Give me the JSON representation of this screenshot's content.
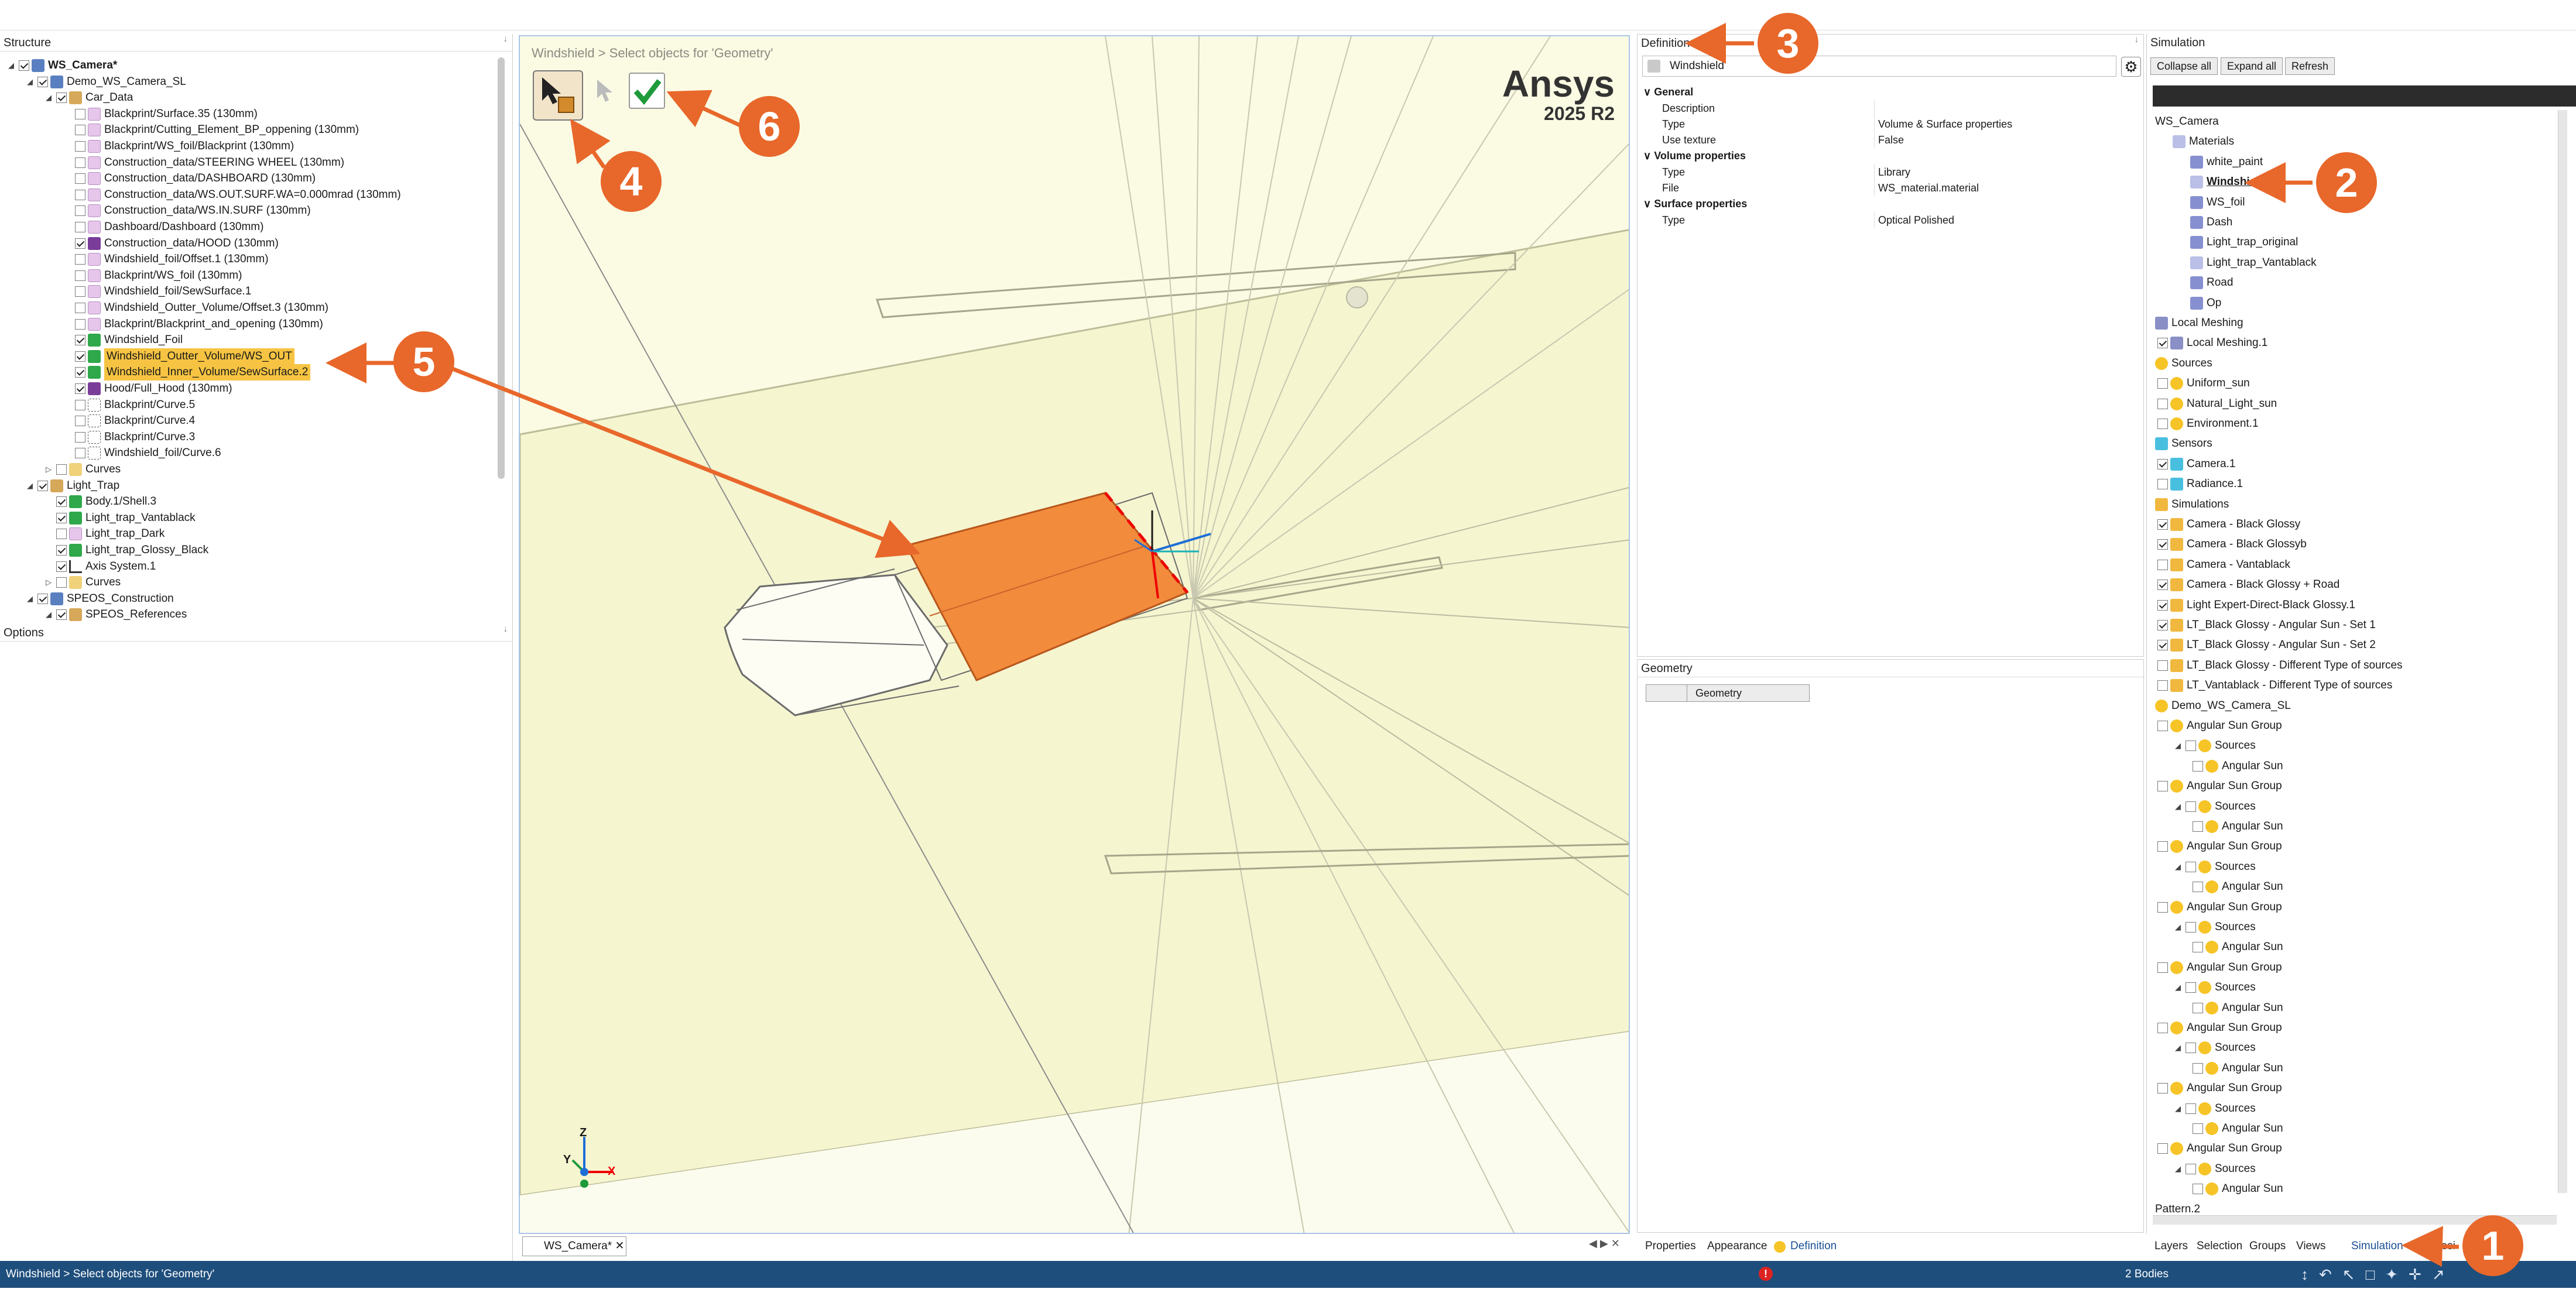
{
  "structure": {
    "title": "Structure",
    "rows": [
      {
        "label": "WS_Camera*",
        "bold": true
      },
      {
        "label": "Demo_WS_Camera_SL"
      },
      {
        "label": "Car_Data"
      },
      {
        "label": "Blackprint/Surface.35 (130mm)"
      },
      {
        "label": "Blackprint/Cutting_Element_BP_oppening (130mm)"
      },
      {
        "label": "Blackprint/WS_foil/Blackprint (130mm)"
      },
      {
        "label": "Construction_data/STEERING WHEEL (130mm)"
      },
      {
        "label": "Construction_data/DASHBOARD (130mm)"
      },
      {
        "label": "Construction_data/WS.OUT.SURF.WA=0.000mrad (130mm)"
      },
      {
        "label": "Construction_data/WS.IN.SURF (130mm)"
      },
      {
        "label": "Dashboard/Dashboard (130mm)"
      },
      {
        "label": "Construction_data/HOOD (130mm)"
      },
      {
        "label": "Windshield_foil/Offset.1 (130mm)"
      },
      {
        "label": "Blackprint/WS_foil (130mm)"
      },
      {
        "label": "Windshield_foil/SewSurface.1"
      },
      {
        "label": "Windshield_Outter_Volume/Offset.3 (130mm)"
      },
      {
        "label": "Blackprint/Blackprint_and_opening (130mm)"
      },
      {
        "label": "Windshield_Foil"
      },
      {
        "label": "Windshield_Outter_Volume/WS_OUT"
      },
      {
        "label": "Windshield_Inner_Volume/SewSurface.2"
      },
      {
        "label": "Hood/Full_Hood (130mm)"
      },
      {
        "label": "Blackprint/Curve.5"
      },
      {
        "label": "Blackprint/Curve.4"
      },
      {
        "label": "Blackprint/Curve.3"
      },
      {
        "label": "Windshield_foil/Curve.6"
      },
      {
        "label": "Curves"
      },
      {
        "label": "Light_Trap"
      },
      {
        "label": "Body.1/Shell.3"
      },
      {
        "label": "Light_trap_Vantablack"
      },
      {
        "label": "Light_trap_Dark"
      },
      {
        "label": "Light_trap_Glossy_Black"
      },
      {
        "label": "Axis System.1"
      },
      {
        "label": "Curves"
      },
      {
        "label": "SPEOS_Construction"
      },
      {
        "label": "SPEOS_References"
      }
    ]
  },
  "options": {
    "title": "Options"
  },
  "viewport": {
    "breadcrumb": "Windshield > Select objects for 'Geometry'",
    "brand": "Ansys",
    "version": "2025 R2",
    "axis_x": "X",
    "axis_y": "Y",
    "axis_z": "Z",
    "tab": "WS_Camera*"
  },
  "definition": {
    "title": "Definition",
    "name": "Windshield",
    "sections": [
      {
        "title": "General",
        "props": [
          [
            "Description",
            ""
          ],
          [
            "Type",
            "Volume & Surface properties"
          ],
          [
            "Use texture",
            "False"
          ]
        ]
      },
      {
        "title": "Volume properties",
        "props": [
          [
            "Type",
            "Library"
          ],
          [
            "File",
            "WS_material.material"
          ]
        ]
      },
      {
        "title": "Surface properties",
        "props": [
          [
            "Type",
            "Optical Polished"
          ]
        ]
      }
    ]
  },
  "geometry": {
    "title": "Geometry",
    "column": "Geometry"
  },
  "center_tabs": [
    "Properties",
    "Appearance",
    "Definition"
  ],
  "simulation": {
    "title": "Simulation",
    "buttons": [
      "Collapse all",
      "Expand all",
      "Refresh"
    ],
    "rows": [
      {
        "label": "WS_Camera"
      },
      {
        "label": "Materials"
      },
      {
        "label": "white_paint"
      },
      {
        "label": "Windshield"
      },
      {
        "label": "WS_foil"
      },
      {
        "label": "Dash"
      },
      {
        "label": "Light_trap_original"
      },
      {
        "label": "Light_trap_Vantablack"
      },
      {
        "label": "Road"
      },
      {
        "label": "Op"
      },
      {
        "label": "Local Meshing"
      },
      {
        "label": "Local Meshing.1"
      },
      {
        "label": "Sources"
      },
      {
        "label": "Uniform_sun"
      },
      {
        "label": "Natural_Light_sun"
      },
      {
        "label": "Environment.1"
      },
      {
        "label": "Sensors"
      },
      {
        "label": "Camera.1"
      },
      {
        "label": "Radiance.1"
      },
      {
        "label": "Simulations"
      },
      {
        "label": "Camera -  Black Glossy"
      },
      {
        "label": "Camera -  Black Glossyb"
      },
      {
        "label": "Camera - Vantablack"
      },
      {
        "label": "Camera - Black Glossy + Road"
      },
      {
        "label": "Light Expert-Direct-Black Glossy.1"
      },
      {
        "label": "LT_Black Glossy - Angular Sun - Set 1"
      },
      {
        "label": "LT_Black Glossy - Angular Sun - Set 2"
      },
      {
        "label": "LT_Black Glossy - Different Type of sources"
      },
      {
        "label": "LT_Vantablack - Different Type of sources"
      },
      {
        "label": "Demo_WS_Camera_SL"
      },
      {
        "label": "Angular Sun Group"
      },
      {
        "label": "Sources"
      },
      {
        "label": "Angular Sun"
      },
      {
        "label": "Angular Sun Group"
      },
      {
        "label": "Sources"
      },
      {
        "label": "Angular Sun"
      },
      {
        "label": "Angular Sun Group"
      },
      {
        "label": "Sources"
      },
      {
        "label": "Angular Sun"
      },
      {
        "label": "Angular Sun Group"
      },
      {
        "label": "Sources"
      },
      {
        "label": "Angular Sun"
      },
      {
        "label": "Angular Sun Group"
      },
      {
        "label": "Sources"
      },
      {
        "label": "Angular Sun"
      },
      {
        "label": "Angular Sun Group"
      },
      {
        "label": "Sources"
      },
      {
        "label": "Angular Sun"
      },
      {
        "label": "Angular Sun Group"
      },
      {
        "label": "Sources"
      },
      {
        "label": "Angular Sun"
      },
      {
        "label": "Angular Sun Group"
      },
      {
        "label": "Sources"
      },
      {
        "label": "Angular Sun"
      },
      {
        "label": "Pattern.2"
      }
    ]
  },
  "right_tabs": [
    "Layers",
    "Selection",
    "Groups",
    "Views",
    "Simulation",
    "Desi"
  ],
  "status": {
    "text": "Windshield > Select objects for 'Geometry'",
    "bodies": "2 Bodies"
  },
  "callouts": [
    "1",
    "2",
    "3",
    "4",
    "5",
    "6"
  ],
  "colors": {
    "accent": "#e8672a",
    "highlight": "#f6c442",
    "statusbar": "#1e4e7c",
    "viewport": "#fbfbe4"
  }
}
